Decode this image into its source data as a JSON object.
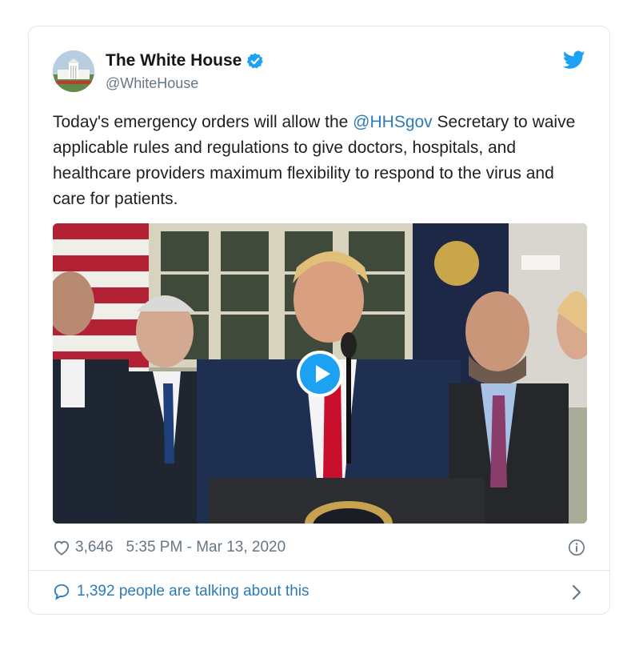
{
  "tweet": {
    "author_name": "The White House",
    "handle": "@WhiteHouse",
    "text_before": "Today's emergency orders will allow the ",
    "mention": "@HHSgov",
    "text_after": " Secretary to waive applicable rules and regulations to give doctors, hospitals, and healthcare providers maximum flexibility to respond to the virus and care for patients.",
    "likes": "3,646",
    "timestamp": "5:35 PM - Mar 13, 2020",
    "talking": "1,392 people are talking about this"
  },
  "colors": {
    "link": "#2b7bb9",
    "twitter_blue": "#1da1f2",
    "secondary_text": "#657786",
    "border": "#e1e8ed"
  },
  "icons": {
    "verified": "verified-badge-icon",
    "brand": "twitter-bird-icon",
    "play": "play-icon",
    "like": "heart-icon",
    "info": "info-icon",
    "reply": "speech-bubble-icon",
    "more": "chevron-right-icon"
  }
}
